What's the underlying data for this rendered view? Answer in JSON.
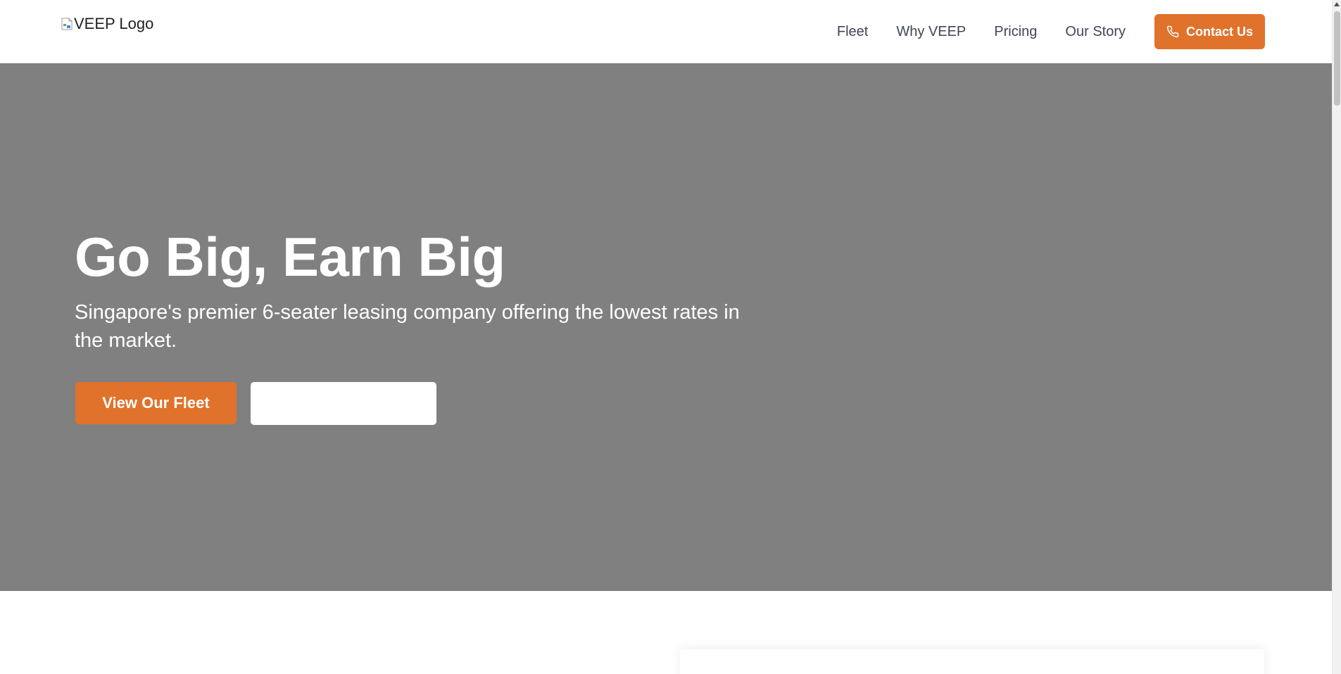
{
  "header": {
    "logo_alt": "VEEP Logo",
    "nav": [
      {
        "label": "Fleet"
      },
      {
        "label": "Why VEEP"
      },
      {
        "label": "Pricing"
      },
      {
        "label": "Our Story"
      }
    ],
    "contact_label": "Contact Us",
    "contact_icon": "phone-icon"
  },
  "hero": {
    "title": "Go Big, Earn Big",
    "subtitle": "Singapore's premier 6-seater leasing company offering the lowest rates in the market.",
    "primary_label": "View Our Fleet",
    "secondary_label": ""
  },
  "colors": {
    "accent": "#e0722b",
    "hero_background": "#808080",
    "nav_text": "#3f4654"
  }
}
